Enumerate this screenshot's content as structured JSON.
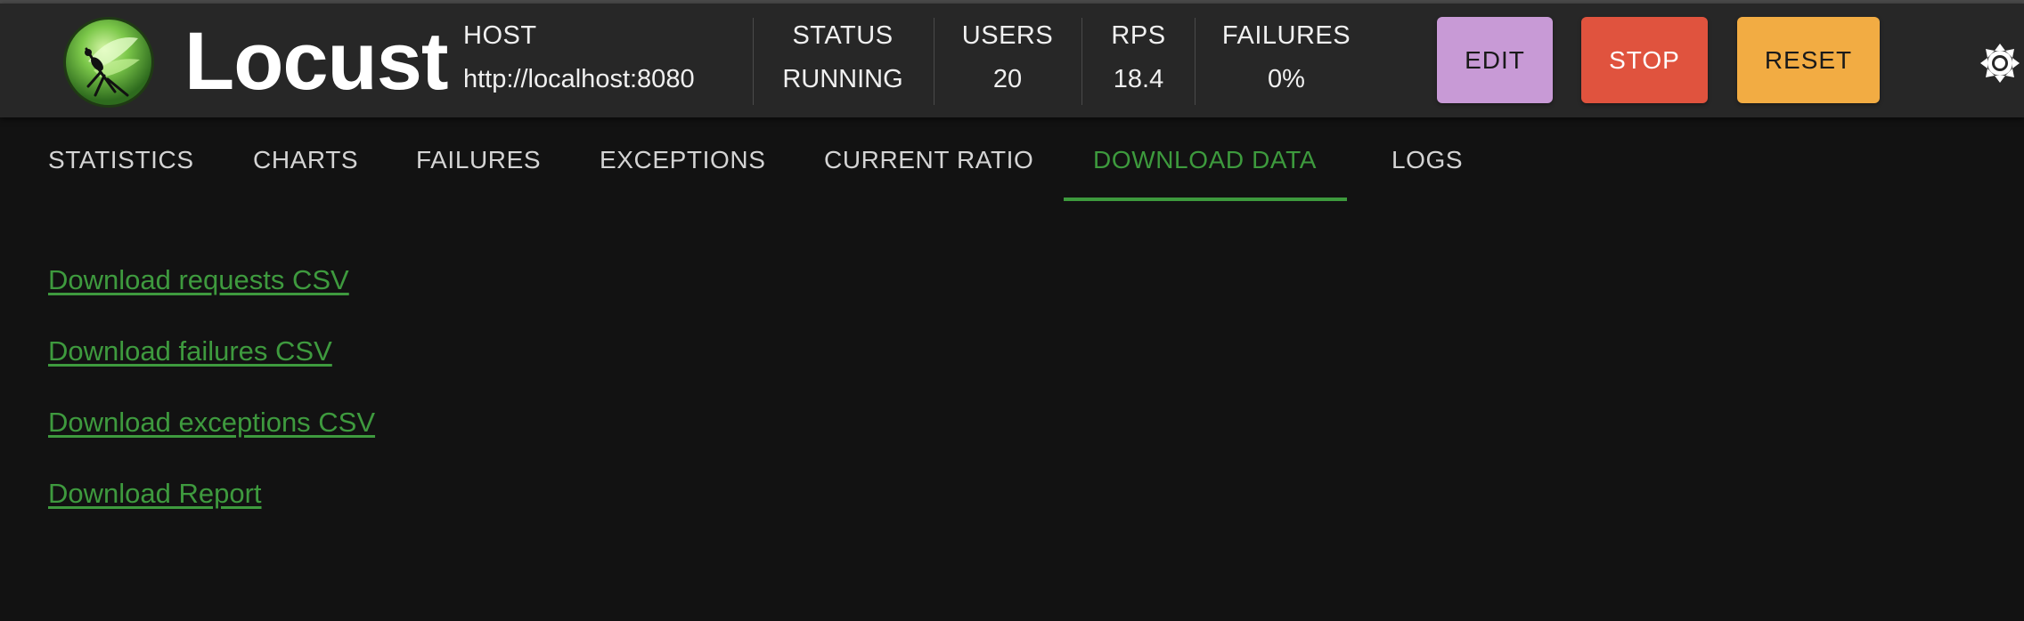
{
  "brand": {
    "name": "Locust"
  },
  "stats": {
    "host": {
      "label": "HOST",
      "value": "http://localhost:8080"
    },
    "status": {
      "label": "STATUS",
      "value": "RUNNING"
    },
    "users": {
      "label": "USERS",
      "value": "20"
    },
    "rps": {
      "label": "RPS",
      "value": "18.4"
    },
    "failures": {
      "label": "FAILURES",
      "value": "0%"
    }
  },
  "buttons": {
    "edit": "EDIT",
    "stop": "STOP",
    "reset": "RESET"
  },
  "tabs": [
    {
      "label": "STATISTICS",
      "active": false
    },
    {
      "label": "CHARTS",
      "active": false
    },
    {
      "label": "FAILURES",
      "active": false
    },
    {
      "label": "EXCEPTIONS",
      "active": false
    },
    {
      "label": "CURRENT RATIO",
      "active": false
    },
    {
      "label": "DOWNLOAD DATA",
      "active": true
    },
    {
      "label": "LOGS",
      "active": false
    }
  ],
  "downloads": [
    "Download requests CSV",
    "Download failures CSV",
    "Download exceptions CSV",
    "Download Report"
  ],
  "colors": {
    "accent_green": "#3d9a3d",
    "edit_button": "#c89ad6",
    "stop_button": "#e0533e",
    "reset_button": "#f2ac43",
    "header_bg": "#272727",
    "page_bg": "#121212"
  },
  "icons": {
    "logo": "locust-logo-icon",
    "theme_toggle": "sun-gear-icon"
  }
}
